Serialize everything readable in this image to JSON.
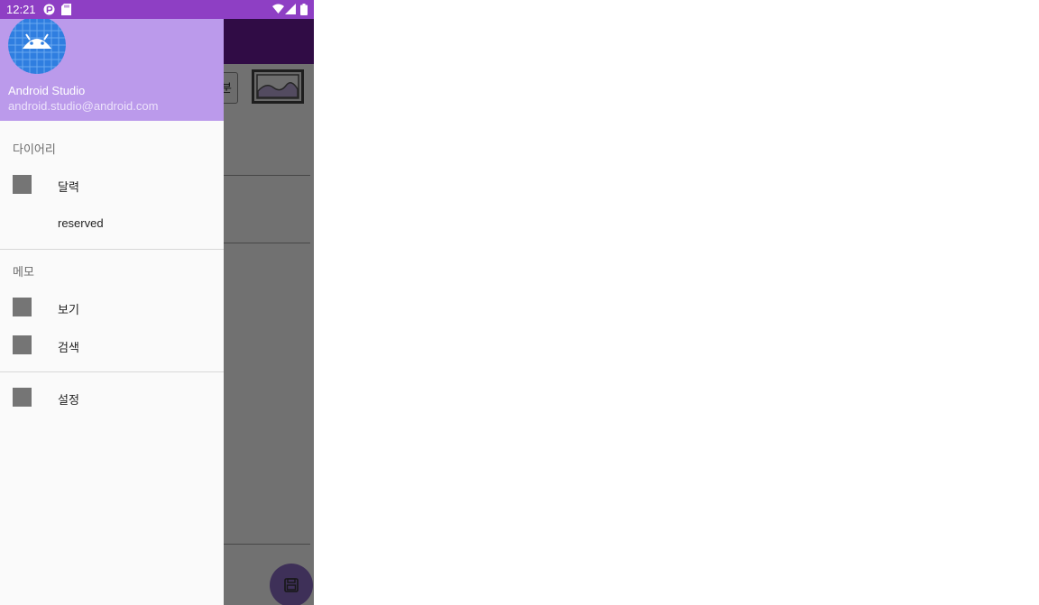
{
  "status_bar": {
    "time": "12:21",
    "icons": [
      "notification-p-icon",
      "sd-card-icon",
      "wifi-icon",
      "signal-icon",
      "battery-icon"
    ],
    "background": "#8e3fc4"
  },
  "background_screen": {
    "button_label": "분",
    "toolbar_color": "#6a1b9a",
    "fab_icon": "save-icon"
  },
  "drawer": {
    "header": {
      "name": "Android Studio",
      "email": "android.studio@android.com",
      "background": "#bb9aeb"
    },
    "sections": {
      "diary": {
        "title": "다이어리",
        "items": [
          {
            "label": "달력",
            "icon": "placeholder-icon"
          },
          {
            "label": "reserved"
          }
        ]
      },
      "memo": {
        "title": "메모",
        "items": [
          {
            "label": "보기",
            "icon": "placeholder-icon"
          },
          {
            "label": "검색",
            "icon": "placeholder-icon"
          }
        ]
      },
      "settings": {
        "items": [
          {
            "label": "설정",
            "icon": "placeholder-icon"
          }
        ]
      }
    }
  }
}
